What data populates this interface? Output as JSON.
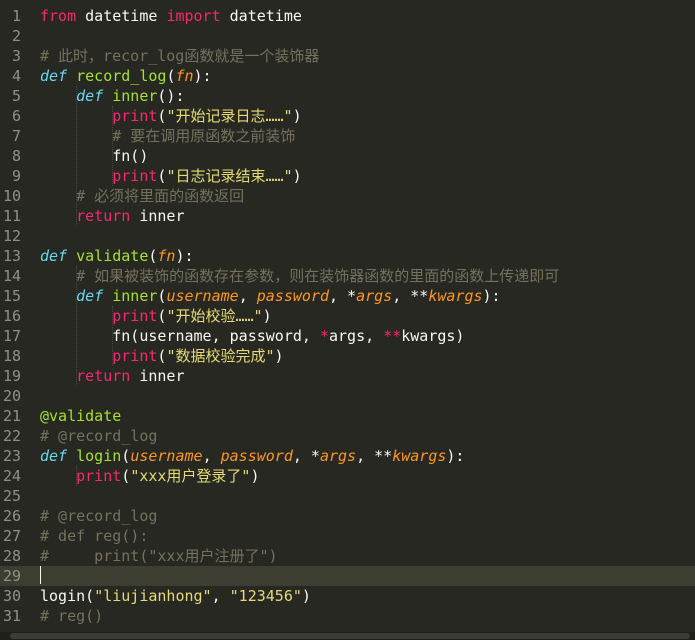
{
  "editor": {
    "current_line": 29,
    "lines": [
      {
        "n": "1",
        "tokens": [
          {
            "t": "from",
            "c": "kw"
          },
          {
            "t": " datetime ",
            "c": "pl"
          },
          {
            "t": "import",
            "c": "kw"
          },
          {
            "t": " datetime",
            "c": "pl"
          }
        ]
      },
      {
        "n": "2",
        "tokens": []
      },
      {
        "n": "3",
        "tokens": [
          {
            "t": "# 此时，recor_log函数就是一个装饰器",
            "c": "cm"
          }
        ]
      },
      {
        "n": "4",
        "tokens": [
          {
            "t": "def",
            "c": "sk"
          },
          {
            "t": " ",
            "c": "pl"
          },
          {
            "t": "record_log",
            "c": "fn"
          },
          {
            "t": "(",
            "c": "pl"
          },
          {
            "t": "fn",
            "c": "pa"
          },
          {
            "t": "):",
            "c": "pl"
          }
        ]
      },
      {
        "n": "5",
        "tokens": [
          {
            "t": "    ",
            "c": "pl"
          },
          {
            "t": "def",
            "c": "sk"
          },
          {
            "t": " ",
            "c": "pl"
          },
          {
            "t": "inner",
            "c": "fn"
          },
          {
            "t": "():",
            "c": "pl"
          }
        ]
      },
      {
        "n": "6",
        "tokens": [
          {
            "t": "        ",
            "c": "pl"
          },
          {
            "t": "print",
            "c": "kw"
          },
          {
            "t": "(",
            "c": "pl"
          },
          {
            "t": "\"开始记录日志……\"",
            "c": "st"
          },
          {
            "t": ")",
            "c": "pl"
          }
        ]
      },
      {
        "n": "7",
        "tokens": [
          {
            "t": "        ",
            "c": "pl"
          },
          {
            "t": "# 要在调用原函数之前装饰",
            "c": "cm"
          }
        ]
      },
      {
        "n": "8",
        "tokens": [
          {
            "t": "        fn()",
            "c": "pl"
          }
        ]
      },
      {
        "n": "9",
        "tokens": [
          {
            "t": "        ",
            "c": "pl"
          },
          {
            "t": "print",
            "c": "kw"
          },
          {
            "t": "(",
            "c": "pl"
          },
          {
            "t": "\"日志记录结束……\"",
            "c": "st"
          },
          {
            "t": ")",
            "c": "pl"
          }
        ]
      },
      {
        "n": "10",
        "tokens": [
          {
            "t": "    ",
            "c": "pl"
          },
          {
            "t": "# 必须将里面的函数返回",
            "c": "cm"
          }
        ]
      },
      {
        "n": "11",
        "tokens": [
          {
            "t": "    ",
            "c": "pl"
          },
          {
            "t": "return",
            "c": "kw"
          },
          {
            "t": " inner",
            "c": "pl"
          }
        ]
      },
      {
        "n": "12",
        "tokens": []
      },
      {
        "n": "13",
        "tokens": [
          {
            "t": "def",
            "c": "sk"
          },
          {
            "t": " ",
            "c": "pl"
          },
          {
            "t": "validate",
            "c": "fn"
          },
          {
            "t": "(",
            "c": "pl"
          },
          {
            "t": "fn",
            "c": "pa"
          },
          {
            "t": "):",
            "c": "pl"
          }
        ]
      },
      {
        "n": "14",
        "tokens": [
          {
            "t": "    ",
            "c": "pl"
          },
          {
            "t": "# 如果被装饰的函数存在参数，则在装饰器函数的里面的函数上传递即可",
            "c": "cm"
          }
        ]
      },
      {
        "n": "15",
        "tokens": [
          {
            "t": "    ",
            "c": "pl"
          },
          {
            "t": "def",
            "c": "sk"
          },
          {
            "t": " ",
            "c": "pl"
          },
          {
            "t": "inner",
            "c": "fn"
          },
          {
            "t": "(",
            "c": "pl"
          },
          {
            "t": "username",
            "c": "pa"
          },
          {
            "t": ", ",
            "c": "pl"
          },
          {
            "t": "password",
            "c": "pa"
          },
          {
            "t": ", *",
            "c": "pl"
          },
          {
            "t": "args",
            "c": "pa"
          },
          {
            "t": ", **",
            "c": "pl"
          },
          {
            "t": "kwargs",
            "c": "pa"
          },
          {
            "t": "):",
            "c": "pl"
          }
        ]
      },
      {
        "n": "16",
        "tokens": [
          {
            "t": "        ",
            "c": "pl"
          },
          {
            "t": "print",
            "c": "kw"
          },
          {
            "t": "(",
            "c": "pl"
          },
          {
            "t": "\"开始校验……\"",
            "c": "st"
          },
          {
            "t": ")",
            "c": "pl"
          }
        ]
      },
      {
        "n": "17",
        "tokens": [
          {
            "t": "        fn(username, password, ",
            "c": "pl"
          },
          {
            "t": "*",
            "c": "kw"
          },
          {
            "t": "args, ",
            "c": "pl"
          },
          {
            "t": "**",
            "c": "kw"
          },
          {
            "t": "kwargs)",
            "c": "pl"
          }
        ]
      },
      {
        "n": "18",
        "tokens": [
          {
            "t": "        ",
            "c": "pl"
          },
          {
            "t": "print",
            "c": "kw"
          },
          {
            "t": "(",
            "c": "pl"
          },
          {
            "t": "\"数据校验完成\"",
            "c": "st"
          },
          {
            "t": ")",
            "c": "pl"
          }
        ]
      },
      {
        "n": "19",
        "tokens": [
          {
            "t": "    ",
            "c": "pl"
          },
          {
            "t": "return",
            "c": "kw"
          },
          {
            "t": " inner",
            "c": "pl"
          }
        ]
      },
      {
        "n": "20",
        "tokens": []
      },
      {
        "n": "21",
        "tokens": [
          {
            "t": "@validate",
            "c": "dc"
          }
        ]
      },
      {
        "n": "22",
        "tokens": [
          {
            "t": "# @record_log",
            "c": "cm"
          }
        ]
      },
      {
        "n": "23",
        "tokens": [
          {
            "t": "def",
            "c": "sk"
          },
          {
            "t": " ",
            "c": "pl"
          },
          {
            "t": "login",
            "c": "fn"
          },
          {
            "t": "(",
            "c": "pl"
          },
          {
            "t": "username",
            "c": "pa"
          },
          {
            "t": ", ",
            "c": "pl"
          },
          {
            "t": "password",
            "c": "pa"
          },
          {
            "t": ", *",
            "c": "pl"
          },
          {
            "t": "args",
            "c": "pa"
          },
          {
            "t": ", **",
            "c": "pl"
          },
          {
            "t": "kwargs",
            "c": "pa"
          },
          {
            "t": "):",
            "c": "pl"
          }
        ]
      },
      {
        "n": "24",
        "tokens": [
          {
            "t": "    ",
            "c": "pl"
          },
          {
            "t": "print",
            "c": "kw"
          },
          {
            "t": "(",
            "c": "pl"
          },
          {
            "t": "\"xxx用户登录了\"",
            "c": "st"
          },
          {
            "t": ")",
            "c": "pl"
          }
        ]
      },
      {
        "n": "25",
        "tokens": []
      },
      {
        "n": "26",
        "tokens": [
          {
            "t": "# @record_log",
            "c": "cm"
          }
        ]
      },
      {
        "n": "27",
        "tokens": [
          {
            "t": "# def reg():",
            "c": "cm"
          }
        ]
      },
      {
        "n": "28",
        "tokens": [
          {
            "t": "#     print(\"xxx用户注册了\")",
            "c": "cm"
          }
        ]
      },
      {
        "n": "29",
        "tokens": []
      },
      {
        "n": "30",
        "tokens": [
          {
            "t": "login(",
            "c": "pl"
          },
          {
            "t": "\"liujianhong\"",
            "c": "st"
          },
          {
            "t": ", ",
            "c": "pl"
          },
          {
            "t": "\"123456\"",
            "c": "st"
          },
          {
            "t": ")",
            "c": "pl"
          }
        ]
      },
      {
        "n": "31",
        "tokens": [
          {
            "t": "# reg()",
            "c": "cm"
          }
        ]
      }
    ]
  },
  "theme": {
    "background": "#272822",
    "keyword": "#f92672",
    "storage": "#66d9ef",
    "function": "#a6e22e",
    "parameter": "#fd971f",
    "string": "#e6db74",
    "comment": "#75715e",
    "foreground": "#f8f8f2"
  }
}
